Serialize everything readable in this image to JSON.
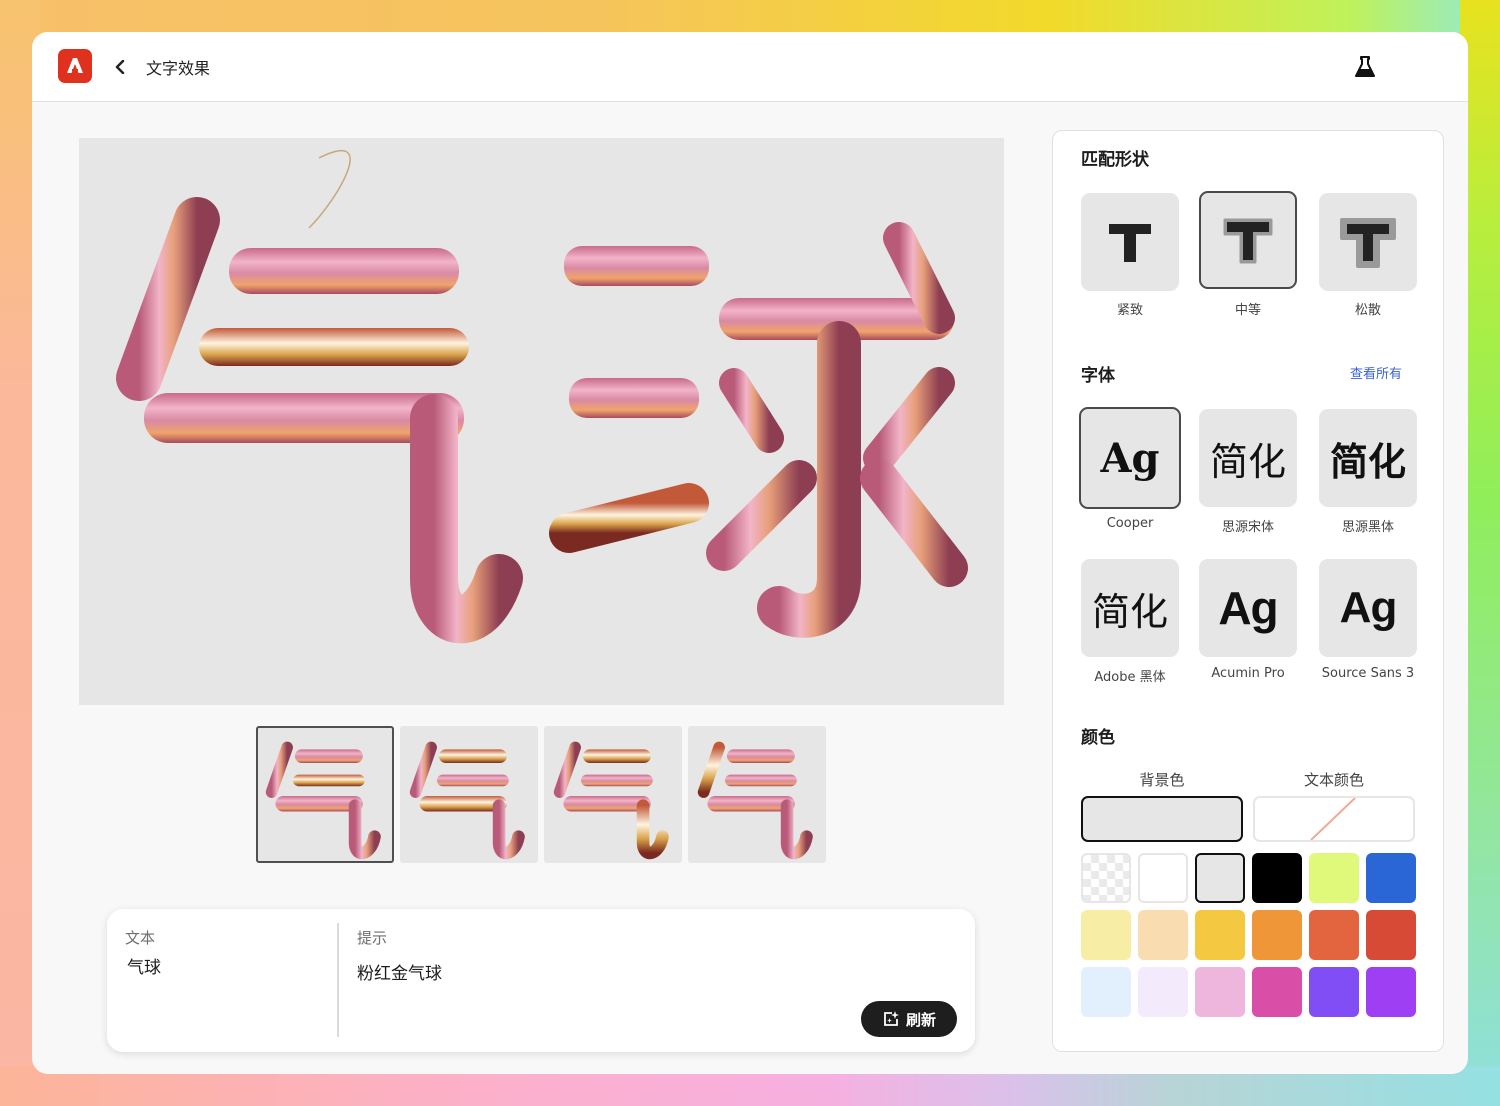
{
  "app": {
    "title": "文字效果",
    "logo_icon": "adobe-express-logo",
    "back_icon": "chevron-left-icon",
    "labs_icon": "flask-icon"
  },
  "preview": {
    "text": "气球",
    "alt": "Pink-gold balloon styled characters 气球"
  },
  "thumbnails": [
    {
      "char": "气",
      "selected": true
    },
    {
      "char": "气",
      "selected": false
    },
    {
      "char": "气",
      "selected": false
    },
    {
      "char": "气",
      "selected": false
    }
  ],
  "prompt": {
    "text_label": "文本",
    "text_value": "气球",
    "prompt_label": "提示",
    "prompt_value": "粉红金气球",
    "refresh_label": "刷新",
    "refresh_icon": "sparkle-refresh-icon"
  },
  "panel": {
    "shape": {
      "title": "匹配形状",
      "options": [
        {
          "label": "紧致",
          "glyph": "T",
          "selected": false
        },
        {
          "label": "中等",
          "glyph": "T",
          "selected": true
        },
        {
          "label": "松散",
          "glyph": "T",
          "selected": false
        }
      ]
    },
    "font": {
      "title": "字体",
      "see_all": "查看所有",
      "options": [
        {
          "label": "Cooper",
          "glyph": "Ag",
          "selected": true
        },
        {
          "label": "思源宋体",
          "glyph": "简化",
          "selected": false
        },
        {
          "label": "思源黑体",
          "glyph": "简化",
          "selected": false
        },
        {
          "label": "Adobe 黑体",
          "glyph": "简化",
          "selected": false
        },
        {
          "label": "Acumin Pro",
          "glyph": "Ag",
          "selected": false
        },
        {
          "label": "Source Sans 3",
          "glyph": "Ag",
          "selected": false
        }
      ]
    },
    "color": {
      "title": "颜色",
      "background_label": "背景色",
      "text_label": "文本颜色",
      "background_value": "#e6e6e6",
      "text_value": "none",
      "swatches": [
        {
          "name": "transparent",
          "hex": "transparent"
        },
        {
          "name": "white",
          "hex": "#ffffff"
        },
        {
          "name": "light-gray",
          "hex": "#e6e6e6",
          "selected": true
        },
        {
          "name": "black",
          "hex": "#000000"
        },
        {
          "name": "lime",
          "hex": "#e0f97a"
        },
        {
          "name": "blue",
          "hex": "#2a66d6"
        },
        {
          "name": "pale-yellow",
          "hex": "#f7eda4"
        },
        {
          "name": "peach",
          "hex": "#f9ddb0"
        },
        {
          "name": "yellow",
          "hex": "#f5c842"
        },
        {
          "name": "orange",
          "hex": "#ef9638"
        },
        {
          "name": "coral",
          "hex": "#e3653f"
        },
        {
          "name": "red",
          "hex": "#d64a36"
        },
        {
          "name": "pale-blue",
          "hex": "#e2effd"
        },
        {
          "name": "pale-lavender",
          "hex": "#f3eafb"
        },
        {
          "name": "pink",
          "hex": "#eeb6dd"
        },
        {
          "name": "magenta",
          "hex": "#d94fa7"
        },
        {
          "name": "violet",
          "hex": "#804ef4"
        },
        {
          "name": "purple",
          "hex": "#9e3ff4"
        }
      ]
    }
  }
}
